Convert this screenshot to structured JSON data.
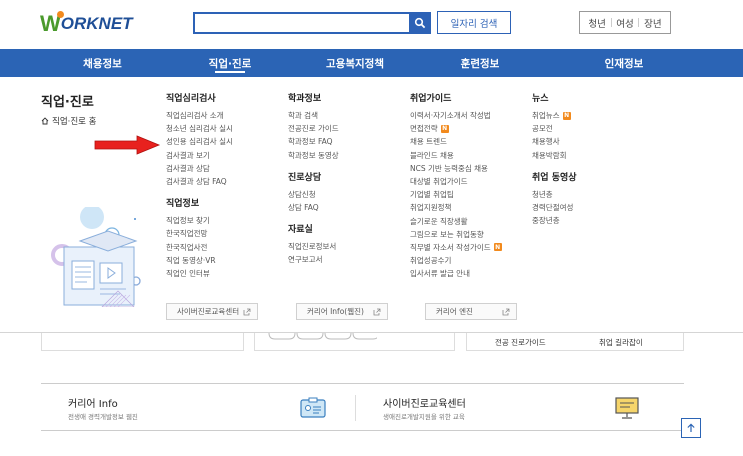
{
  "header": {
    "logo_text": "ORKNET",
    "logo_initial": "W",
    "search_placeholder": "",
    "job_search_label": "일자리 검색",
    "segments": [
      "청년",
      "여성",
      "장년"
    ]
  },
  "nav": {
    "items": [
      "채용정보",
      "직업·진로",
      "고용복지정책",
      "훈련정보",
      "인재정보"
    ],
    "active_index": 1
  },
  "menu": {
    "section_title": "직업·진로",
    "home_link": "직업·진로 홈",
    "col1": {
      "group1_title": "직업심리검사",
      "group1_items": [
        "직업심리검사 소개",
        "청소년 심리검사 실시",
        "성인용 심리검사 실시",
        "검사결과 보기",
        "검사결과 상담",
        "검사결과 상담 FAQ"
      ],
      "group2_title": "직업정보",
      "group2_items": [
        "직업정보 찾기",
        "한국직업전망",
        "한국직업사전",
        "직업 동영상·VR",
        "직업인 인터뷰"
      ]
    },
    "col2": {
      "group1_title": "학과정보",
      "group1_items": [
        "학과 검색",
        "전공진로 가이드",
        "학과정보 FAQ",
        "학과정보 동영상"
      ],
      "group2_title": "진로상담",
      "group2_items": [
        "상담신청",
        "상담 FAQ"
      ],
      "group3_title": "자료실",
      "group3_items": [
        "직업진로정보서",
        "연구보고서"
      ]
    },
    "col3": {
      "group1_title": "취업가이드",
      "group1_items": [
        "이력서·자기소개서 작성법",
        "면접전략",
        "채용 트렌드",
        "블라인드 채용",
        "NCS 기반 능력중심 채용",
        "대상별 취업가이드",
        "기업별 취업팁",
        "취업지원정책",
        "슬기로운 직장생활",
        "그림으로 보는 취업동향",
        "직무별 자소서 작성가이드",
        "취업성공수기",
        "입사서류 발급 안내"
      ],
      "badge_items": [
        1,
        10
      ]
    },
    "col4": {
      "group1_title": "뉴스",
      "group1_items": [
        "취업뉴스",
        "공모전",
        "채용행사",
        "채용박람회"
      ],
      "badge_items": [
        0
      ],
      "group2_title": "취업 동영상",
      "group2_items": [
        "청년층",
        "경력단절여성",
        "중장년층"
      ]
    },
    "badge_text": "N",
    "bottom_links": [
      "사이버진로교육센터",
      "커리어 Info(웹진)",
      "커리어 엔진"
    ]
  },
  "below": {
    "tab_labels": [
      "전공 진로가이드",
      "취업 길라잡이"
    ],
    "card1_title": "커리어 Info",
    "card1_sub": "전생애 경력개발정보 웹진",
    "card2_title": "사이버진로교육센터",
    "card2_sub": "생애진로개발지원을 위한 교육"
  },
  "colors": {
    "brand_blue": "#2b64b5",
    "brand_green": "#4a9a2c",
    "badge_orange": "#f28a1d",
    "arrow_red": "#e8211e"
  }
}
